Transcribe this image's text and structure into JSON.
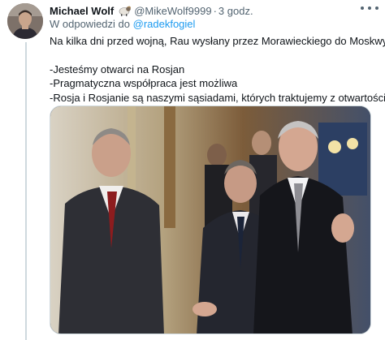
{
  "tweet": {
    "display_name": "Michael Wolf",
    "name_emoji": "ram-emoji",
    "handle": "@MikeWolf9999",
    "separator": "·",
    "time": "3 godz.",
    "reply_prefix": "W odpowiedzi do",
    "reply_mention": "@radekfogiel",
    "text_lines": [
      "Na kilka dni przed wojną, Rau wysłany przez Morawieckiego do Moskwy:",
      "-Jesteśmy otwarci na Rosjan",
      "-Pragmatyczna współpraca jest możliwa",
      "-Rosja i Rosjanie są naszymi sąsiadami, których traktujemy z otwartością"
    ]
  },
  "colors": {
    "link": "#1d9bf0",
    "secondary_text": "#536471",
    "primary_text": "#0f1419",
    "thread_line": "#cfd9de"
  },
  "icons": {
    "more": "more-horizontal-icon",
    "avatar": "user-avatar"
  }
}
